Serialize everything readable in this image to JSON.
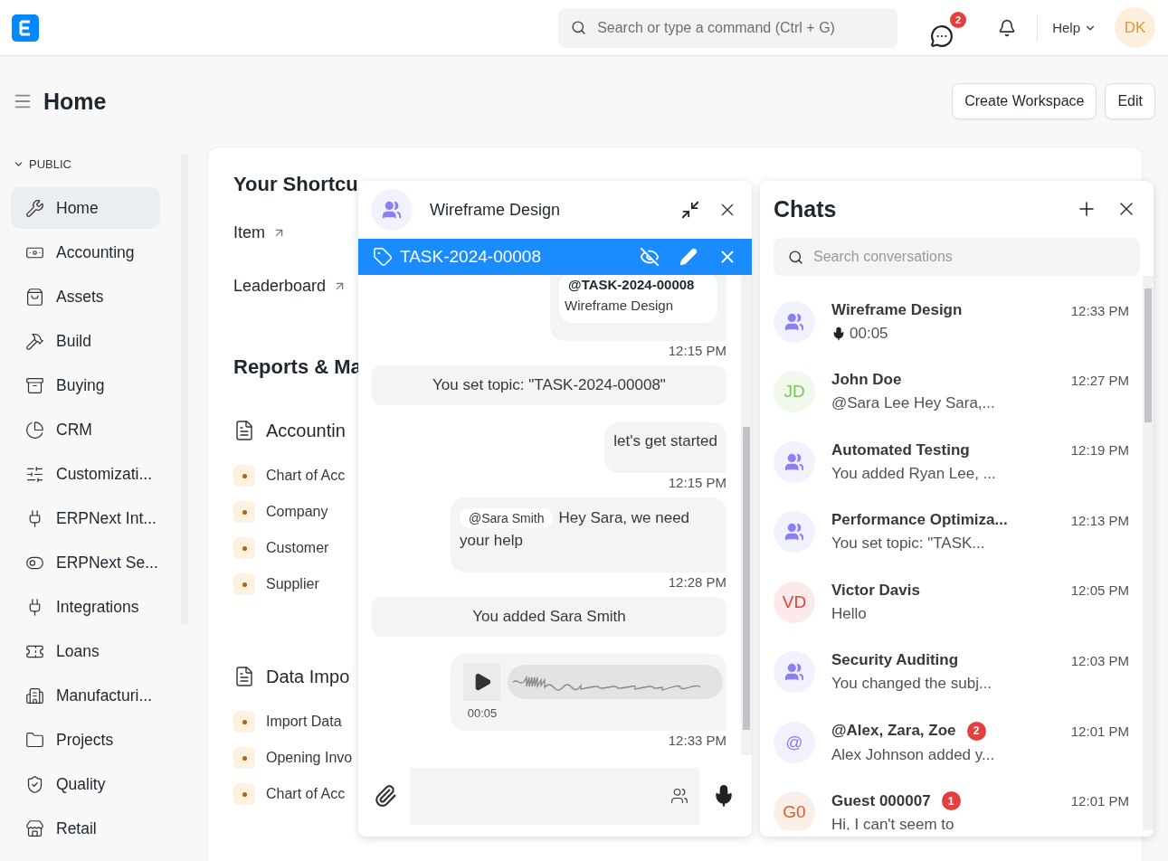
{
  "navbar": {
    "search_placeholder": "Search or type a command (Ctrl + G)",
    "chat_badge": "2",
    "help": "Help",
    "avatar": "DK"
  },
  "page_header": {
    "title": "Home",
    "buttons": [
      "Create Workspace",
      "Edit"
    ]
  },
  "sidebar": {
    "section": "PUBLIC",
    "expanded": true,
    "items": [
      {
        "label": "Home",
        "selected": true
      },
      {
        "label": "Accounting",
        "selected": false
      },
      {
        "label": "Assets",
        "selected": false
      },
      {
        "label": "Build",
        "selected": false
      },
      {
        "label": "Buying",
        "selected": false
      },
      {
        "label": "CRM",
        "selected": false
      },
      {
        "label": "Customizati...",
        "selected": false
      },
      {
        "label": "ERPNext Int...",
        "selected": false
      },
      {
        "label": "ERPNext Se...",
        "selected": false
      },
      {
        "label": "Integrations",
        "selected": false
      },
      {
        "label": "Loans",
        "selected": false
      },
      {
        "label": "Manufacturi...",
        "selected": false
      },
      {
        "label": "Projects",
        "selected": false
      },
      {
        "label": "Quality",
        "selected": false
      },
      {
        "label": "Retail",
        "selected": false
      }
    ]
  },
  "workspace": {
    "shortcuts_title": "Your Shortcu",
    "shortcuts": [
      "Item",
      "Leaderboard"
    ],
    "reports_title": "Reports & Ma",
    "cards": [
      {
        "title": "Accountin",
        "links": [
          "Chart of Acc",
          "Company",
          "Customer",
          "Supplier"
        ]
      },
      {
        "title": "Data Impo",
        "links": [
          "Import Data",
          "Opening Invo",
          "Chart of Acc"
        ]
      }
    ]
  },
  "chat_window": {
    "title": "Wireframe Design",
    "topic": "TASK-2024-00008",
    "messages": [
      {
        "kind": "quote",
        "ref": "@TASK-2024-00008",
        "subtitle": "Wireframe Design",
        "time": "12:15 PM"
      },
      {
        "kind": "system",
        "text": "You set topic: \"TASK-2024-00008\""
      },
      {
        "kind": "text",
        "text": "let's get started",
        "time": "12:15 PM"
      },
      {
        "kind": "mention",
        "mention": "@Sara Smith",
        "text": "Hey Sara, we need your help",
        "time": "12:28 PM"
      },
      {
        "kind": "system",
        "text": "You added Sara Smith"
      },
      {
        "kind": "voice",
        "duration": "00:05",
        "time": "12:33 PM"
      }
    ]
  },
  "chats_panel": {
    "title": "Chats",
    "search_placeholder": "Search conversations",
    "conversations": [
      {
        "name": "Wireframe Design",
        "preview": "00:05",
        "voice": true,
        "time": "12:33 PM",
        "kind": "group",
        "color": "#8b7ff5"
      },
      {
        "name": "John Doe",
        "preview": "@Sara Lee Hey Sara,...",
        "time": "12:27 PM",
        "voice": false,
        "kind": "initials",
        "initials": "JD",
        "color": "#7cc85a"
      },
      {
        "name": "Automated Testing",
        "preview": "You added Ryan Lee, ...",
        "time": "12:19 PM",
        "voice": false,
        "kind": "group",
        "color": "#8b7ff5"
      },
      {
        "name": "Performance Optimiza...",
        "preview": "You set topic: \"TASK...",
        "time": "12:13 PM",
        "voice": false,
        "kind": "group",
        "color": "#8b7ff5"
      },
      {
        "name": "Victor Davis",
        "preview": "Hello",
        "time": "12:05 PM",
        "voice": false,
        "kind": "initials",
        "initials": "VD",
        "color": "#e2403f"
      },
      {
        "name": "Security Auditing",
        "preview": "You changed the subj...",
        "time": "12:03 PM",
        "voice": false,
        "kind": "group",
        "color": "#8b7ff5"
      },
      {
        "name": "@Alex, Zara, Zoe",
        "preview": "Alex Johnson added y...",
        "time": "12:01 PM",
        "voice": false,
        "kind": "initials",
        "initials": "@",
        "color": "#8b7ff5",
        "unread": "2"
      },
      {
        "name": "Guest 000007",
        "preview": "Hi, I can't seem to",
        "time": "12:01 PM",
        "voice": false,
        "kind": "initials",
        "initials": "G0",
        "color": "#d4602c",
        "unread": "1"
      }
    ]
  }
}
